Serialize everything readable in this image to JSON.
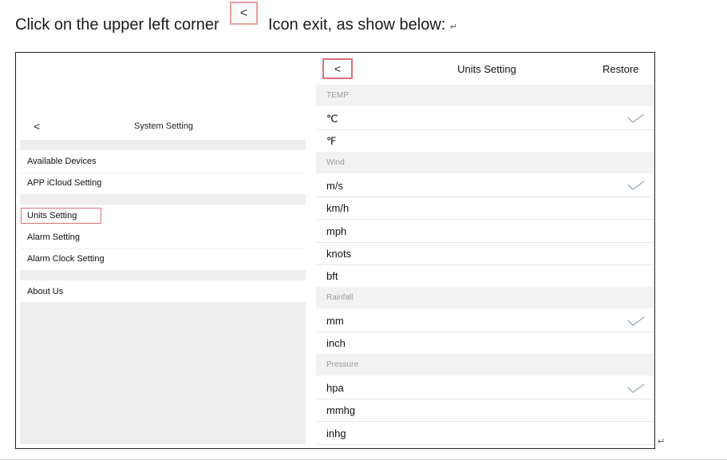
{
  "instruction": {
    "text_before": "Click on the upper left corner",
    "back_glyph": "<",
    "text_after": "Icon exit, as show below:",
    "para_mark": "↵"
  },
  "left_panel": {
    "back_glyph": "<",
    "title": "System Setting",
    "items": [
      "Available Devices",
      "APP iCloud Setting",
      "Units Setting",
      "Alarm Setting",
      "Alarm Clock Setting",
      "About Us"
    ]
  },
  "right_panel": {
    "back_glyph": "<",
    "title": "Units Setting",
    "restore_label": "Restore",
    "sections": [
      {
        "header": "TEMP",
        "options": [
          "℃",
          "℉"
        ],
        "selected": "℃"
      },
      {
        "header": "Wind",
        "options": [
          "m/s",
          "km/h",
          "mph",
          "knots",
          "bft"
        ],
        "selected": "m/s"
      },
      {
        "header": "Rainfall",
        "options": [
          "mm",
          "inch"
        ],
        "selected": "mm"
      },
      {
        "header": "Pressure",
        "options": [
          "hpa",
          "mmhg",
          "inhg"
        ],
        "selected": "hpa"
      }
    ]
  },
  "colors": {
    "highlight_box": "#d9707a",
    "checkmark": "#9aaab5",
    "section_background": "#f2f2f2"
  },
  "icons": [
    "back-chevron-icon",
    "checkmark-icon"
  ]
}
